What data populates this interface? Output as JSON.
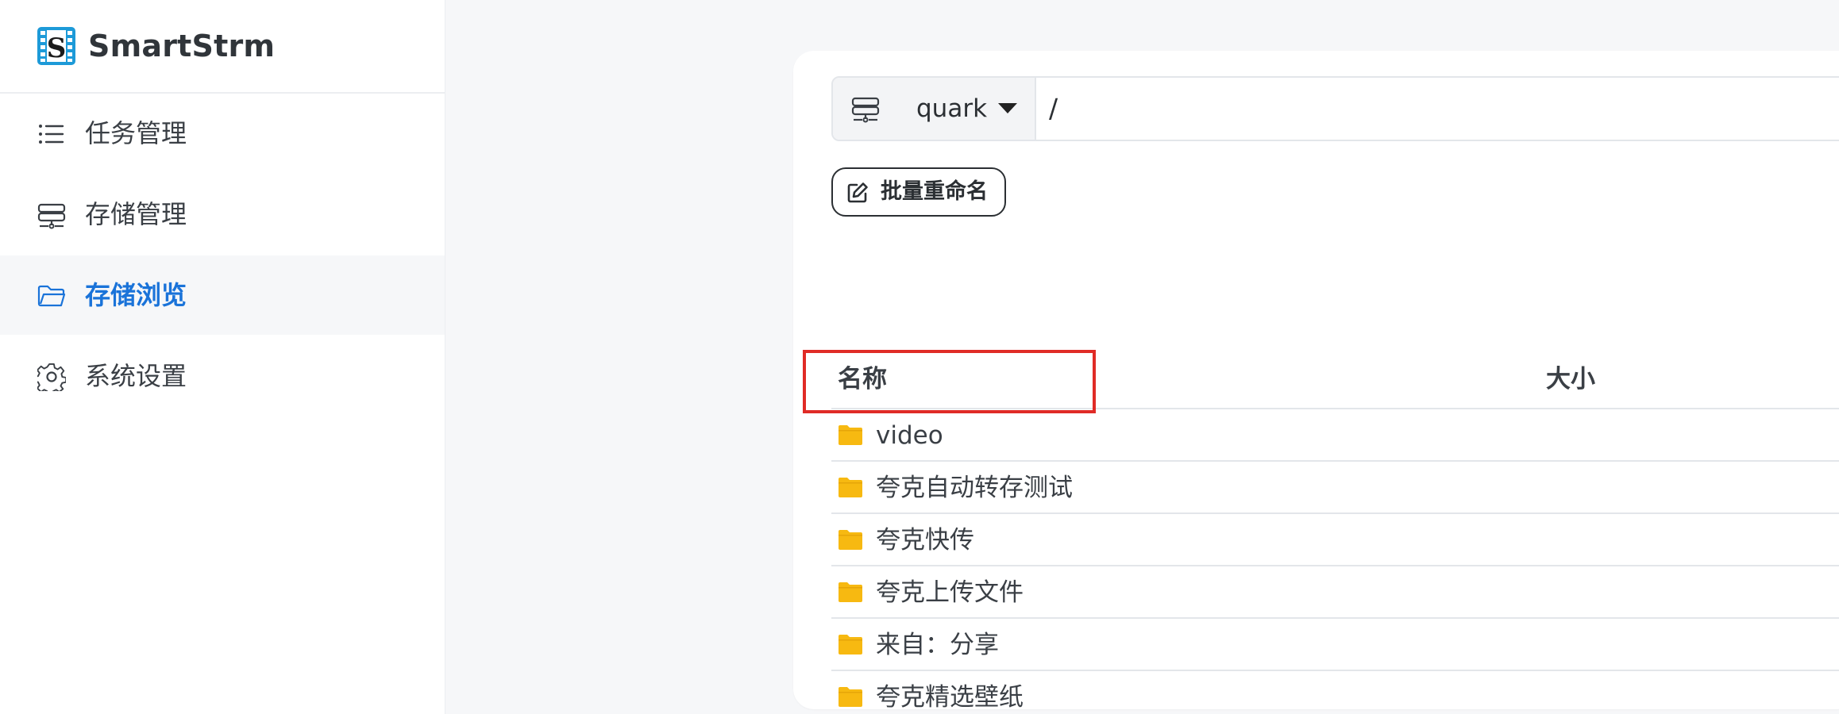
{
  "app": {
    "brand_name": "SmartStrm",
    "logo_letter": "S",
    "accent_color": "#1a73d9"
  },
  "sidebar": {
    "items": [
      {
        "label": "任务管理",
        "icon": "list-icon",
        "active": false
      },
      {
        "label": "存储管理",
        "icon": "storage-icon",
        "active": false
      },
      {
        "label": "存储浏览",
        "icon": "folder-open-icon",
        "active": true
      },
      {
        "label": "系统设置",
        "icon": "gear-icon",
        "active": false
      }
    ]
  },
  "pathbar": {
    "storage_icon": "storage-icon",
    "selected_storage": "quark",
    "path": "/"
  },
  "toolbar": {
    "batch_rename_label": "批量重命名",
    "batch_rename_icon": "edit-icon"
  },
  "table": {
    "columns": {
      "name": "名称",
      "size": "大小"
    },
    "rows": [
      {
        "name": "video",
        "type": "folder",
        "size": ""
      },
      {
        "name": "夸克自动转存测试",
        "type": "folder",
        "size": ""
      },
      {
        "name": "夸克快传",
        "type": "folder",
        "size": ""
      },
      {
        "name": "夸克上传文件",
        "type": "folder",
        "size": ""
      },
      {
        "name": "来自：分享",
        "type": "folder",
        "size": ""
      },
      {
        "name": "夸克精选壁纸",
        "type": "folder",
        "size": ""
      }
    ],
    "folder_color": "#f7b911"
  },
  "annotation": {
    "highlight_color": "#e02b26",
    "highlighted_row": "video"
  }
}
